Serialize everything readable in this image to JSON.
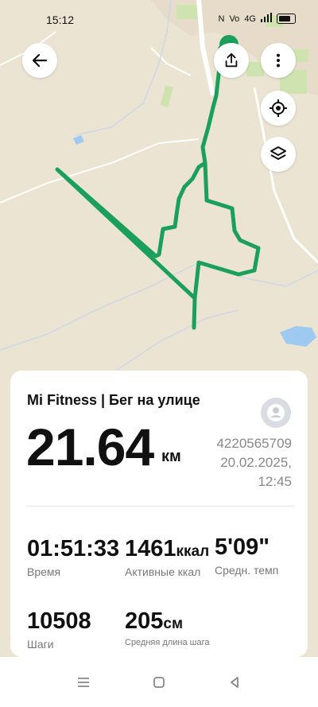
{
  "status_bar": {
    "time": "15:12",
    "network": "4G"
  },
  "map_controls": {
    "back_icon": "arrow-left-icon",
    "share_icon": "share-icon",
    "more_icon": "more-vertical-icon",
    "locate_icon": "locate-icon",
    "layers_icon": "layers-icon"
  },
  "workout": {
    "title": "Mi Fitness | Бег на улице",
    "distance": "21.64",
    "distance_unit": "км",
    "user_id": "4220565709",
    "date": "20.02.2025,",
    "time": "12:45"
  },
  "stats": {
    "duration": {
      "value": "01:51:33",
      "label": "Время"
    },
    "calories": {
      "value": "1461",
      "unit": "ккал",
      "label": "Активные ккал"
    },
    "pace": {
      "value": "5'09\"",
      "label": "Средн. темп"
    },
    "steps": {
      "value": "10508",
      "label": "Шаги"
    },
    "stride": {
      "value": "205",
      "unit": "см",
      "label": "Средняя длина шага"
    }
  },
  "colors": {
    "route": "#1aa05a",
    "map_bg": "#ece4d3",
    "park": "#cfe3b0",
    "water": "#9ec9f0"
  },
  "nav_bar": {
    "menu_icon": "menu-icon",
    "home_icon": "home-square-icon",
    "back_icon": "back-triangle-icon"
  }
}
